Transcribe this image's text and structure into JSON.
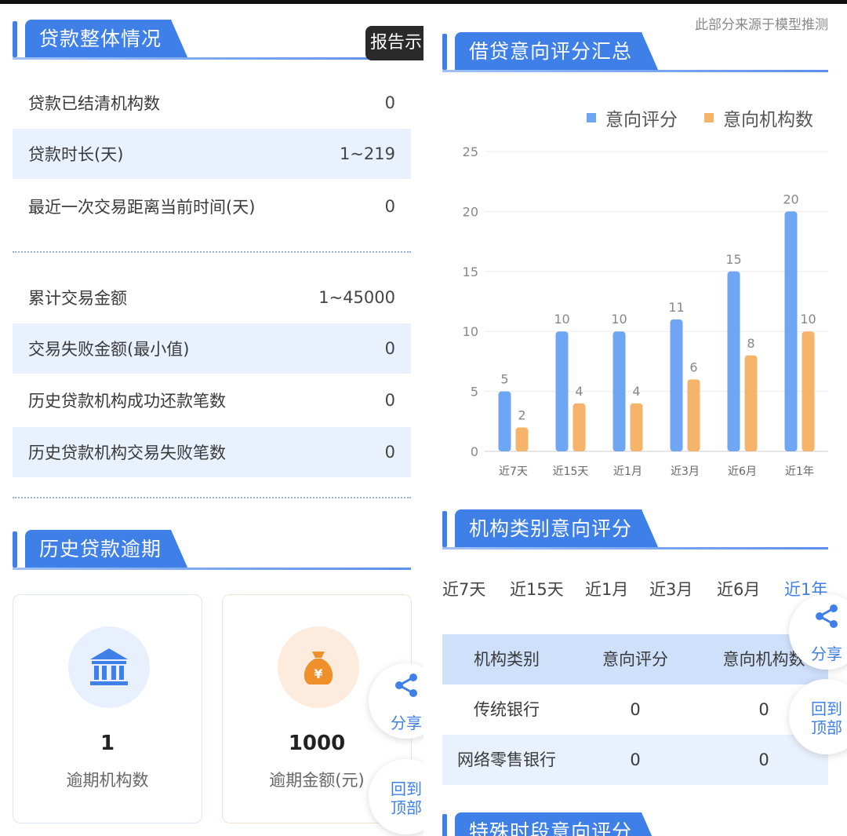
{
  "left": {
    "report_button": "报告示",
    "loan_overview": {
      "title": "贷款整体情况",
      "rows": [
        {
          "label": "贷款已结清机构数",
          "value": "0"
        },
        {
          "label": "贷款时长(天)",
          "value": "1~219"
        },
        {
          "label": "最近一次交易距离当前时间(天)",
          "value": "0"
        }
      ],
      "rows2": [
        {
          "label": "累计交易金额",
          "value": "1~45000"
        },
        {
          "label": "交易失败金额(最小值)",
          "value": "0"
        },
        {
          "label": "历史贷款机构成功还款笔数",
          "value": "0"
        },
        {
          "label": "历史贷款机构交易失败笔数",
          "value": "0"
        }
      ]
    },
    "overdue": {
      "title": "历史贷款逾期",
      "cards": [
        {
          "value": "1",
          "label": "逾期机构数",
          "icon": "bank-icon"
        },
        {
          "value": "1000",
          "label": "逾期金额(元)",
          "icon": "money-bag-icon"
        }
      ]
    },
    "share_label": "分享",
    "back_top_label1": "回到",
    "back_top_label2": "顶部"
  },
  "right": {
    "source_note": "此部分来源于模型推测",
    "intent_summary": {
      "title": "借贷意向评分汇总"
    },
    "category": {
      "title": "机构类别意向评分",
      "tabs": [
        "近7天",
        "近15天",
        "近1月",
        "近3月",
        "近6月",
        "近1年"
      ],
      "active_tab": "近1年",
      "table_headers": [
        "机构类别",
        "意向评分",
        "意向机构数"
      ],
      "table_rows": [
        [
          "传统银行",
          "0",
          "0"
        ],
        [
          "网络零售银行",
          "0",
          "0"
        ]
      ]
    },
    "special": {
      "title": "特殊时段意向评分"
    },
    "share_label": "分享",
    "back_top_label1": "回到",
    "back_top_label2": "顶部"
  },
  "chart_data": {
    "type": "bar",
    "categories": [
      "近7天",
      "近15天",
      "近1月",
      "近3月",
      "近6月",
      "近1年"
    ],
    "series": [
      {
        "name": "意向评分",
        "values": [
          5,
          10,
          10,
          11,
          15,
          20
        ],
        "color": "#6ea6f3"
      },
      {
        "name": "意向机构数",
        "values": [
          2,
          4,
          4,
          6,
          8,
          10
        ],
        "color": "#f6b36a"
      }
    ],
    "y_ticks": [
      "0",
      "5",
      "10",
      "15",
      "20",
      "25"
    ],
    "ylim": [
      0,
      25
    ],
    "grid": true,
    "legend_position": "top-right"
  }
}
